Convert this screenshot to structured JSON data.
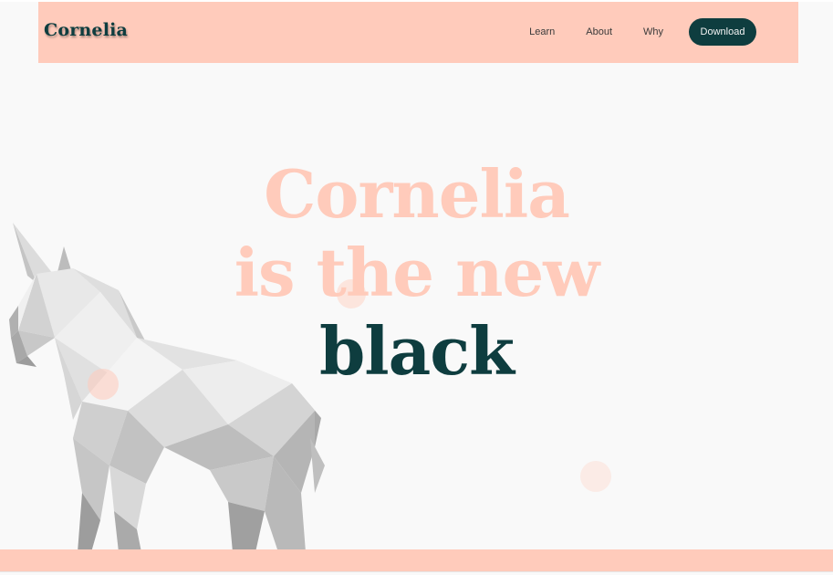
{
  "brand": {
    "name": "Cornelia"
  },
  "nav": {
    "links": [
      "Learn",
      "About",
      "Why"
    ],
    "download_label": "Download"
  },
  "hero": {
    "line1": "Cornelia",
    "line2": "is the new",
    "line3": "black"
  },
  "colors": {
    "peach": "#ffcbbb",
    "dark_teal": "#0e3d3f",
    "background": "#f9f9f9"
  },
  "icons": {
    "hero_illustration": "low-poly-unicorn"
  }
}
